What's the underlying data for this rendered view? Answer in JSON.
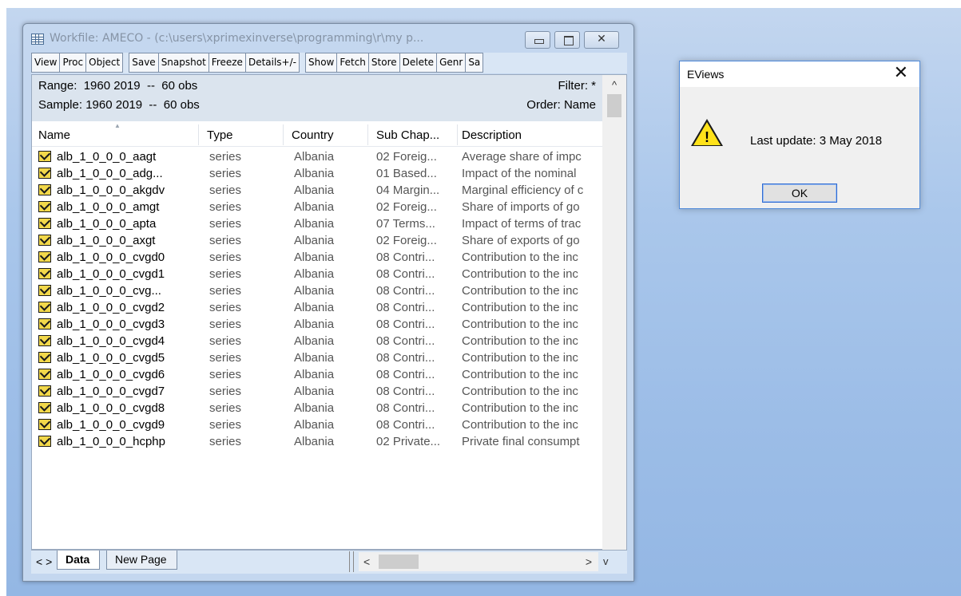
{
  "workfile_window": {
    "title": "Workfile: AMECO - (c:\\users\\xprimexinverse\\programming\\r\\my p...",
    "toolbar_group1": [
      "View",
      "Proc",
      "Object"
    ],
    "toolbar_group2": [
      "Save",
      "Snapshot",
      "Freeze",
      "Details+/-"
    ],
    "toolbar_group3": [
      "Show",
      "Fetch",
      "Store",
      "Delete",
      "Genr",
      "Sa"
    ],
    "range": "Range:  1960 2019  --  60 obs",
    "sample": "Sample: 1960 2019  --  60 obs",
    "filter": "Filter: *",
    "order": "Order: Name",
    "columns": {
      "name": "Name",
      "type": "Type",
      "country": "Country",
      "sub": "Sub Chap...",
      "desc": "Description"
    },
    "rows": [
      {
        "name": "alb_1_0_0_0_aagt",
        "type": "series",
        "country": "Albania",
        "sub": "02 Foreig...",
        "desc": "Average share of impc"
      },
      {
        "name": "alb_1_0_0_0_adg...",
        "type": "series",
        "country": "Albania",
        "sub": "01 Based...",
        "desc": "Impact of the nominal"
      },
      {
        "name": "alb_1_0_0_0_akgdv",
        "type": "series",
        "country": "Albania",
        "sub": "04 Margin...",
        "desc": "Marginal efficiency of c"
      },
      {
        "name": "alb_1_0_0_0_amgt",
        "type": "series",
        "country": "Albania",
        "sub": "02 Foreig...",
        "desc": "Share of imports of go"
      },
      {
        "name": "alb_1_0_0_0_apta",
        "type": "series",
        "country": "Albania",
        "sub": "07 Terms...",
        "desc": "Impact of terms of trac"
      },
      {
        "name": "alb_1_0_0_0_axgt",
        "type": "series",
        "country": "Albania",
        "sub": "02 Foreig...",
        "desc": "Share of exports of go"
      },
      {
        "name": "alb_1_0_0_0_cvgd0",
        "type": "series",
        "country": "Albania",
        "sub": "08 Contri...",
        "desc": "Contribution to the inc"
      },
      {
        "name": "alb_1_0_0_0_cvgd1",
        "type": "series",
        "country": "Albania",
        "sub": "08 Contri...",
        "desc": "Contribution to the inc"
      },
      {
        "name": "alb_1_0_0_0_cvg...",
        "type": "series",
        "country": "Albania",
        "sub": "08 Contri...",
        "desc": "Contribution to the inc"
      },
      {
        "name": "alb_1_0_0_0_cvgd2",
        "type": "series",
        "country": "Albania",
        "sub": "08 Contri...",
        "desc": "Contribution to the inc"
      },
      {
        "name": "alb_1_0_0_0_cvgd3",
        "type": "series",
        "country": "Albania",
        "sub": "08 Contri...",
        "desc": "Contribution to the inc"
      },
      {
        "name": "alb_1_0_0_0_cvgd4",
        "type": "series",
        "country": "Albania",
        "sub": "08 Contri...",
        "desc": "Contribution to the inc"
      },
      {
        "name": "alb_1_0_0_0_cvgd5",
        "type": "series",
        "country": "Albania",
        "sub": "08 Contri...",
        "desc": "Contribution to the inc"
      },
      {
        "name": "alb_1_0_0_0_cvgd6",
        "type": "series",
        "country": "Albania",
        "sub": "08 Contri...",
        "desc": "Contribution to the inc"
      },
      {
        "name": "alb_1_0_0_0_cvgd7",
        "type": "series",
        "country": "Albania",
        "sub": "08 Contri...",
        "desc": "Contribution to the inc"
      },
      {
        "name": "alb_1_0_0_0_cvgd8",
        "type": "series",
        "country": "Albania",
        "sub": "08 Contri...",
        "desc": "Contribution to the inc"
      },
      {
        "name": "alb_1_0_0_0_cvgd9",
        "type": "series",
        "country": "Albania",
        "sub": "08 Contri...",
        "desc": "Contribution to the inc"
      },
      {
        "name": "alb_1_0_0_0_hcphp",
        "type": "series",
        "country": "Albania",
        "sub": "02 Private...",
        "desc": "Private final consumpt"
      }
    ],
    "tabs": {
      "nav": "< >",
      "data": "Data",
      "new_page": "New Page"
    },
    "scroll_glyphs": {
      "up": "^",
      "left": "<",
      "right": ">",
      "down": "v"
    }
  },
  "dialog": {
    "title": "EViews",
    "close_glyph": "✕",
    "icon": "warning-icon",
    "icon_glyph": "!",
    "message": "Last update: 3 May 2018",
    "ok_label": "OK"
  }
}
